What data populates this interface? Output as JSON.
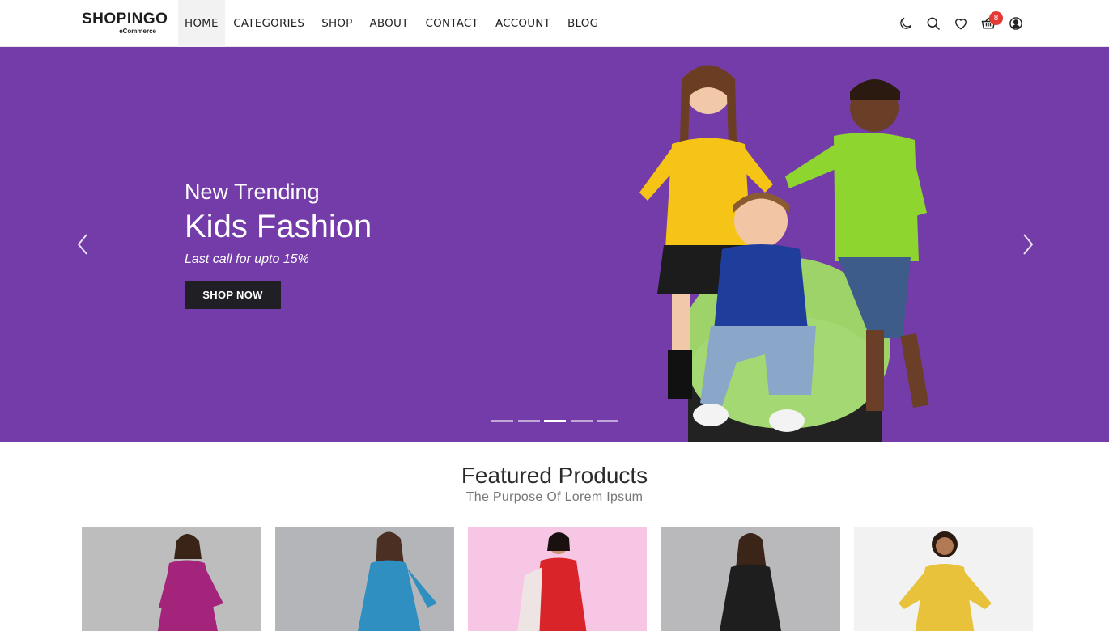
{
  "brand": {
    "name": "SHOPINGO",
    "tagline": "eCommerce"
  },
  "nav": {
    "items": [
      {
        "label": "HOME",
        "active": true
      },
      {
        "label": "CATEGORIES",
        "active": false
      },
      {
        "label": "SHOP",
        "active": false
      },
      {
        "label": "ABOUT",
        "active": false
      },
      {
        "label": "CONTACT",
        "active": false
      },
      {
        "label": "ACCOUNT",
        "active": false
      },
      {
        "label": "BLOG",
        "active": false
      }
    ]
  },
  "header_icons": [
    "moon-icon",
    "search-icon",
    "heart-icon",
    "cart-icon",
    "user-icon"
  ],
  "cart": {
    "count": "8"
  },
  "hero": {
    "subtitle": "New Trending",
    "title": "Kids Fashion",
    "tagline": "Last call for upto 15%",
    "button_label": "SHOP NOW",
    "background": "#743ca8",
    "slides_total": 5,
    "active_slide": 3
  },
  "featured": {
    "title": "Featured Products",
    "subtitle": "The Purpose Of Lorem Ipsum"
  },
  "products": [
    {
      "bg": "#bdbdbd",
      "dress": "#a3247a"
    },
    {
      "bg": "#b3b5b8",
      "dress": "#2f8fc0"
    },
    {
      "bg": "#f6c6e4",
      "dress": "#d9242a"
    },
    {
      "bg": "#b9b9bb",
      "dress": "#1e1e1e"
    },
    {
      "bg": "#f3f2f2",
      "dress": "#e8c23a"
    }
  ],
  "colors": {
    "accent": "#743ca8",
    "badge": "#e53935",
    "button": "#1f1f25"
  }
}
